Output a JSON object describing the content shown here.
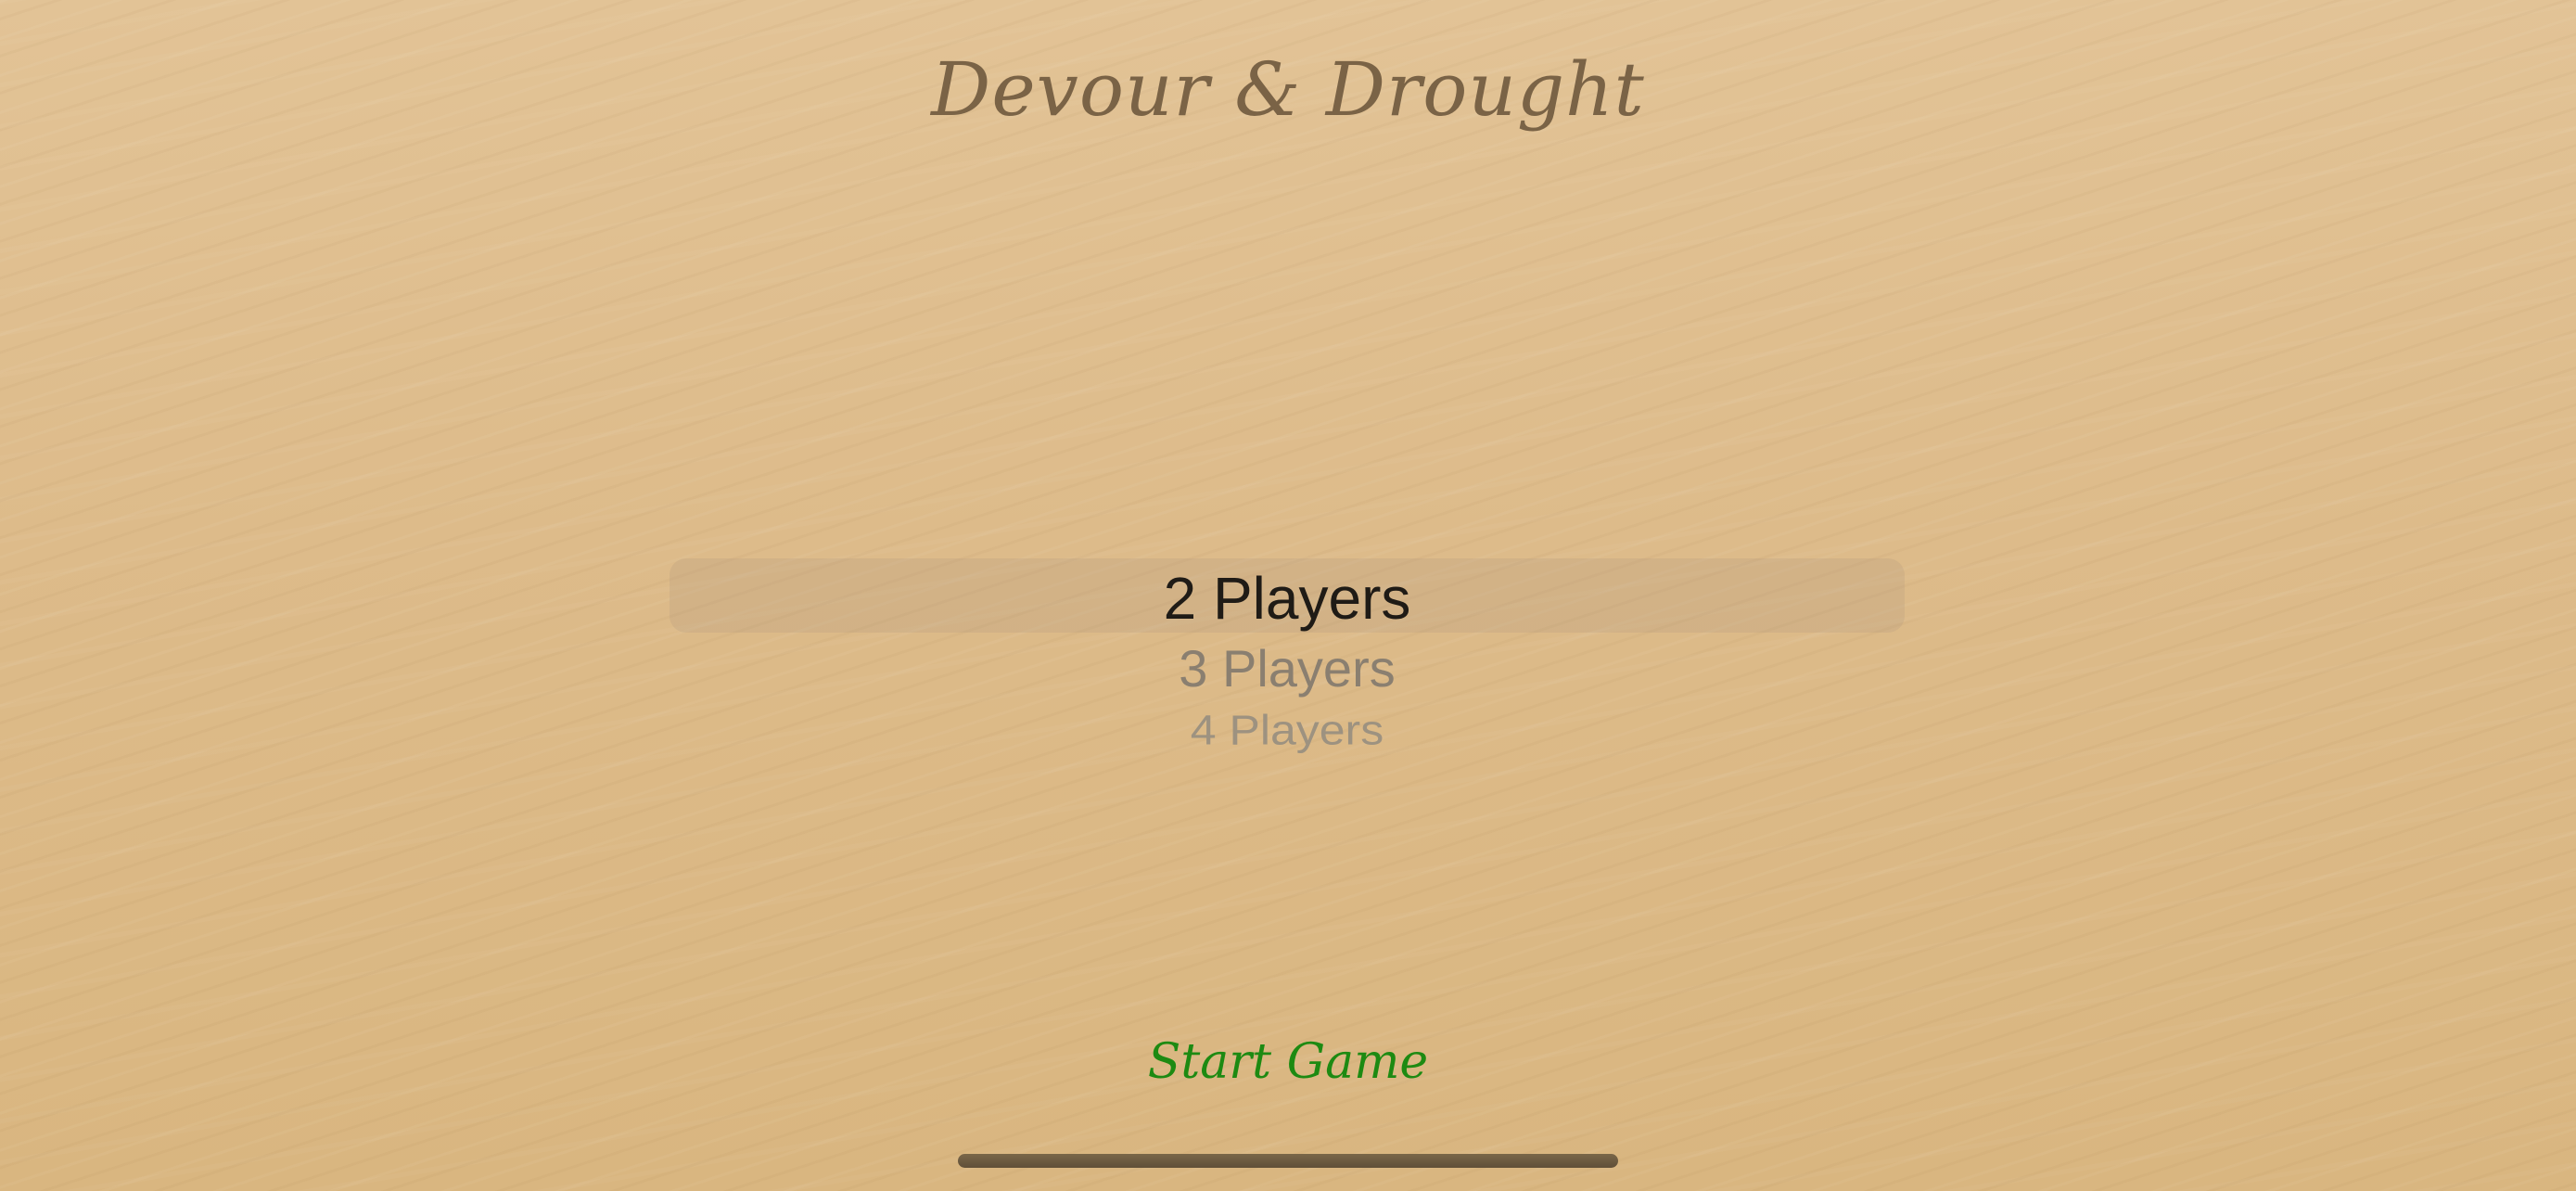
{
  "app": {
    "title": "Devour & Drought"
  },
  "player_picker": {
    "selected_index": 0,
    "options": [
      {
        "label": "2 Players"
      },
      {
        "label": "3 Players"
      },
      {
        "label": "4 Players"
      }
    ]
  },
  "actions": {
    "start_label": "Start Game"
  },
  "colors": {
    "background": "#dfbe8e",
    "title": "#7a6346",
    "selected_option": "#1f1b16",
    "unselected_option": "#8a7f70",
    "start_button": "#1d8a12"
  }
}
